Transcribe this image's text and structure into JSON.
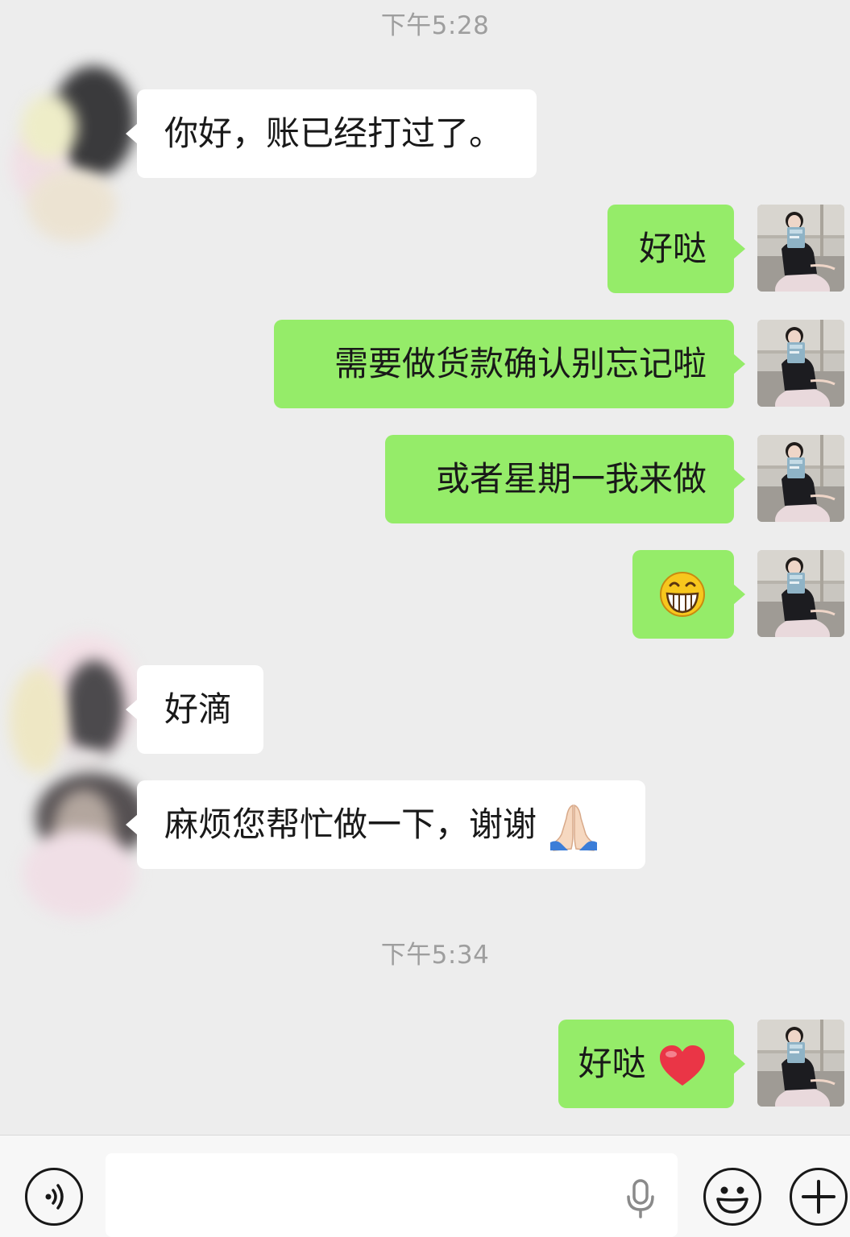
{
  "timestamps": [
    "下午5:28",
    "下午5:34"
  ],
  "messages": [
    {
      "side": "received",
      "text": "你好，账已经打过了。"
    },
    {
      "side": "sent",
      "text": "好哒"
    },
    {
      "side": "sent",
      "text": "需要做货款确认别忘记啦"
    },
    {
      "side": "sent",
      "text": "或者星期一我来做"
    },
    {
      "side": "sent",
      "text": "",
      "emoji": "grinning-face-emoji"
    },
    {
      "side": "received",
      "text": "好滴"
    },
    {
      "side": "received",
      "text": "麻烦您帮忙做一下，谢谢",
      "emoji": "folded-hands-emoji"
    },
    {
      "side": "sent",
      "text": "好哒",
      "emoji": "red-heart-emoji"
    }
  ],
  "input_bar": {
    "voice_icon": "voice-mode-icon",
    "mic_icon": "microphone-icon",
    "emoji_icon": "emoji-icon",
    "plus_icon": "plus-icon",
    "input_value": ""
  },
  "colors": {
    "background": "#ededed",
    "sent_bubble": "#95ec69",
    "received_bubble": "#ffffff",
    "timestamp_text": "#9e9e9e"
  }
}
